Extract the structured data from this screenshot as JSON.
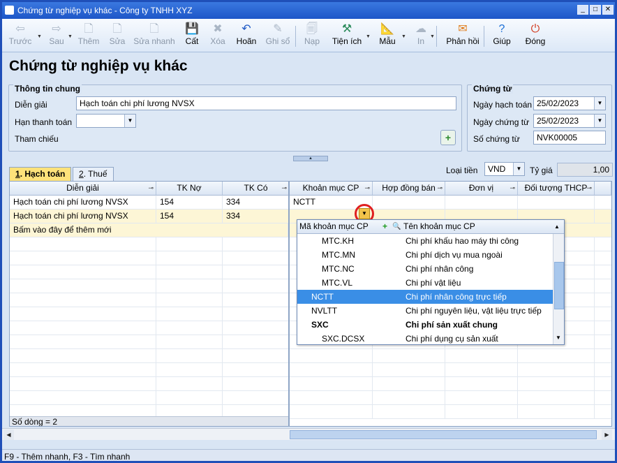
{
  "window": {
    "title": "Chứng từ nghiệp vụ khác - Công ty TNHH XYZ",
    "min": "_",
    "max": "□",
    "close": "✕"
  },
  "toolbar": [
    {
      "label": "Trước",
      "icon": "arrow-left-icon",
      "glyph": "⇦",
      "disabled": true
    },
    {
      "label": "Sau",
      "icon": "arrow-right-icon",
      "glyph": "⇨",
      "disabled": true
    },
    {
      "label": "Thêm",
      "icon": "add-document-icon",
      "glyph": "🗋",
      "disabled": true
    },
    {
      "label": "Sửa",
      "icon": "edit-document-icon",
      "glyph": "🗋",
      "disabled": true
    },
    {
      "label": "Sửa nhanh",
      "icon": "quick-edit-icon",
      "glyph": "🗋",
      "disabled": true
    },
    {
      "label": "Cất",
      "icon": "save-icon",
      "glyph": "💾",
      "disabled": false
    },
    {
      "label": "Xóa",
      "icon": "delete-icon",
      "glyph": "✖",
      "disabled": true
    },
    {
      "label": "Hoãn",
      "icon": "undo-icon",
      "glyph": "↶",
      "disabled": false
    },
    {
      "label": "Ghi sổ",
      "icon": "post-ledger-icon",
      "glyph": "✎",
      "disabled": true
    },
    {
      "label": "Nạp",
      "icon": "reload-icon",
      "glyph": "🗐",
      "disabled": true
    },
    {
      "label": "Tiện ích",
      "icon": "tools-icon",
      "glyph": "⚒",
      "disabled": false
    },
    {
      "label": "Mẫu",
      "icon": "template-icon",
      "glyph": "📐",
      "disabled": false
    },
    {
      "label": "In",
      "icon": "print-icon",
      "glyph": "☁",
      "disabled": true
    },
    {
      "label": "Phản hồi",
      "icon": "feedback-mail-icon",
      "glyph": "✉",
      "disabled": false
    },
    {
      "label": "Giúp",
      "icon": "help-icon",
      "glyph": "?",
      "disabled": false
    },
    {
      "label": "Đóng",
      "icon": "close-form-icon",
      "glyph": "⏻",
      "disabled": false
    }
  ],
  "page_title": "Chứng từ nghiệp vụ khác",
  "general": {
    "group_title": "Thông tin chung",
    "dien_giai_label": "Diễn giải",
    "dien_giai_value": "Hạch toán chi phí lương NVSX",
    "han_tt_label": "Hạn thanh toán",
    "han_tt_value": "",
    "tham_chieu_label": "Tham chiếu"
  },
  "voucher": {
    "group_title": "Chứng từ",
    "ngay_ht_label": "Ngày hạch toán",
    "ngay_ht_value": "25/02/2023",
    "ngay_ct_label": "Ngày chứng từ",
    "ngay_ct_value": "25/02/2023",
    "so_ct_label": "Số chứng từ",
    "so_ct_value": "NVK00005"
  },
  "tabs": [
    {
      "num": "1",
      "text": ". Hạch toán"
    },
    {
      "num": "2",
      "text": ". Thuế"
    }
  ],
  "currency": {
    "label": "Loại tiền",
    "value": "VND",
    "rate_label": "Tỷ giá",
    "rate_value": "1,00"
  },
  "grid": {
    "headers": [
      "Diễn giải",
      "TK Nợ",
      "TK Có",
      "Khoản mục CP",
      "Hợp đồng bán",
      "Đơn vị",
      "Đối tượng THCP"
    ],
    "rows": [
      [
        "Hạch toán chi phí lương NVSX",
        "154",
        "334",
        "NCTT",
        "",
        "",
        ""
      ],
      [
        "Hạch toán chi phí lương NVSX",
        "154",
        "334",
        "",
        "",
        "",
        ""
      ]
    ],
    "add_new": "Bấm vào đây để thêm mới",
    "row_count": "Số dòng = 2"
  },
  "popup": {
    "col1": "Mã khoản mục CP",
    "col2": "Tên khoản mục CP",
    "items": [
      {
        "code": "MTC.KH",
        "name": "Chi phí khấu hao máy thi công",
        "level": 2,
        "bold": false,
        "selected": false
      },
      {
        "code": "MTC.MN",
        "name": "Chi phí dịch vụ mua ngoài",
        "level": 2,
        "bold": false,
        "selected": false
      },
      {
        "code": "MTC.NC",
        "name": "Chi phí nhân công",
        "level": 2,
        "bold": false,
        "selected": false
      },
      {
        "code": "MTC.VL",
        "name": "Chi phí vật liệu",
        "level": 2,
        "bold": false,
        "selected": false
      },
      {
        "code": "NCTT",
        "name": "Chi phí nhân công trực tiếp",
        "level": 1,
        "bold": false,
        "selected": true
      },
      {
        "code": "NVLTT",
        "name": "Chi phí nguyên liệu, vật liệu trực tiếp",
        "level": 1,
        "bold": false,
        "selected": false
      },
      {
        "code": "SXC",
        "name": "Chi phí sản xuất chung",
        "level": 1,
        "bold": true,
        "selected": false
      },
      {
        "code": "SXC.DCSX",
        "name": "Chi phí dụng cụ sản xuất",
        "level": 2,
        "bold": false,
        "selected": false
      }
    ]
  },
  "status": "F9 - Thêm nhanh, F3 - Tìm nhanh"
}
